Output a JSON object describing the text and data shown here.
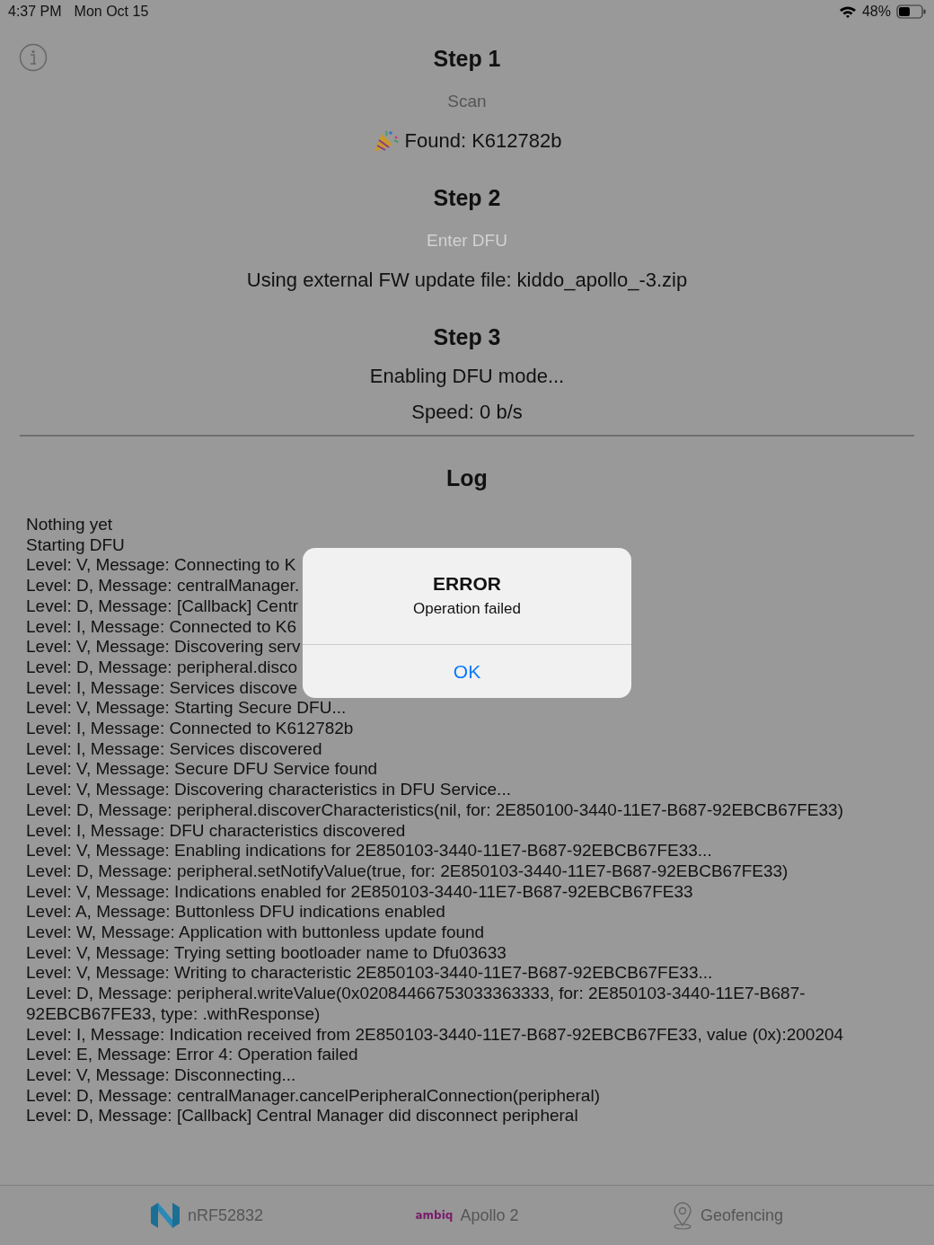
{
  "status_bar": {
    "time": "4:37 PM",
    "date": "Mon Oct 15",
    "battery": "48%"
  },
  "steps": [
    {
      "title": "Step 1",
      "lines": [
        {
          "kind": "subtitle",
          "text": "Scan"
        },
        {
          "kind": "found",
          "text": "Found: K612782b"
        }
      ]
    },
    {
      "title": "Step 2",
      "lines": [
        {
          "kind": "disabled",
          "text": "Enter DFU"
        },
        {
          "kind": "info",
          "text": "Using external FW update file: kiddo_apollo_-3.zip"
        }
      ]
    },
    {
      "title": "Step 3",
      "lines": [
        {
          "kind": "info",
          "text": "Enabling DFU mode..."
        },
        {
          "kind": "info",
          "text": "Speed: 0 b/s"
        }
      ]
    }
  ],
  "log": {
    "title": "Log",
    "lines": [
      "Nothing yet",
      "Starting DFU",
      "Level: V, Message: Connecting to K",
      "Level: D, Message: centralManager.",
      "Level: D, Message: [Callback] Centr",
      "Level: I, Message: Connected to K6",
      "Level: V, Message: Discovering serv",
      "Level: D, Message: peripheral.disco",
      "Level: I, Message: Services discove",
      "Level: V, Message: Starting Secure DFU...",
      "Level: I, Message: Connected to K612782b",
      "Level: I, Message: Services discovered",
      "Level: V, Message: Secure DFU Service found",
      "Level: V, Message: Discovering characteristics in DFU Service...",
      "Level: D, Message: peripheral.discoverCharacteristics(nil, for: 2E850100-3440-11E7-B687-92EBCB67FE33)",
      "Level: I, Message: DFU characteristics discovered",
      "Level: V, Message: Enabling indications for 2E850103-3440-11E7-B687-92EBCB67FE33...",
      "Level: D, Message: peripheral.setNotifyValue(true, for: 2E850103-3440-11E7-B687-92EBCB67FE33)",
      "Level: V, Message: Indications enabled for 2E850103-3440-11E7-B687-92EBCB67FE33",
      "Level: A, Message: Buttonless DFU indications enabled",
      "Level: W, Message: Application with buttonless update found",
      "Level: V, Message: Trying setting bootloader name to Dfu03633",
      "Level: V, Message: Writing to characteristic 2E850103-3440-11E7-B687-92EBCB67FE33...",
      "Level: D, Message: peripheral.writeValue(0x02084466753033363333, for: 2E850103-3440-11E7-B687-92EBCB67FE33, type: .withResponse)",
      "Level: I, Message: Indication received from 2E850103-3440-11E7-B687-92EBCB67FE33, value (0x):200204",
      "Level: E, Message: Error 4: Operation failed",
      "Level: V, Message: Disconnecting...",
      "Level: D, Message: centralManager.cancelPeripheralConnection(peripheral)",
      "Level: D, Message: [Callback] Central Manager did disconnect peripheral"
    ]
  },
  "alert": {
    "title": "ERROR",
    "message": "Operation failed",
    "button": "OK"
  },
  "tab_bar": [
    {
      "kind": "nordic",
      "label": "nRF52832"
    },
    {
      "kind": "ambiq",
      "label": "Apollo 2",
      "logo": "ambiq"
    },
    {
      "kind": "pin",
      "label": "Geofencing"
    }
  ]
}
